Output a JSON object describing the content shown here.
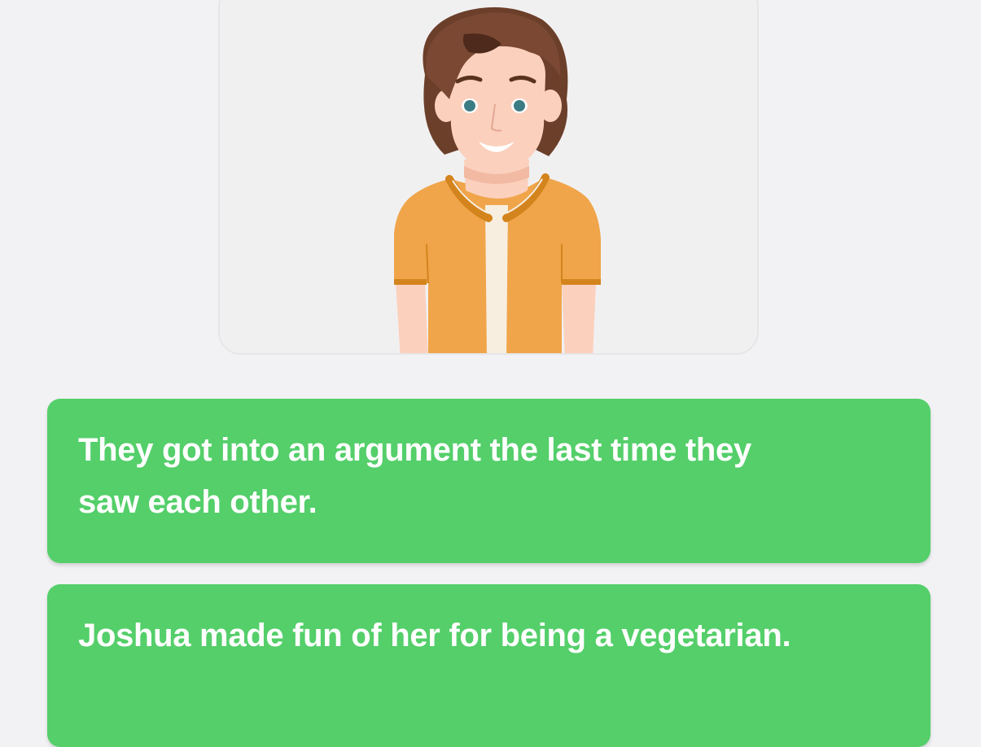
{
  "character": {
    "icon": "man-character-avatar-icon",
    "colors": {
      "hair": "#6b3f2a",
      "skin": "#fbd0bd",
      "shirt": "#f0a54a",
      "shirt_trim": "#d4841d",
      "undershirt": "#f7eee0",
      "eyes": "#3c7c84"
    }
  },
  "options": [
    {
      "label": "They got into an argument the last time they saw each other."
    },
    {
      "label": "Joshua made fun of her for being a vegetarian."
    }
  ],
  "colors": {
    "option_background": "#54cf6a",
    "option_text": "#ffffff",
    "page_background": "#f2f2f4"
  }
}
